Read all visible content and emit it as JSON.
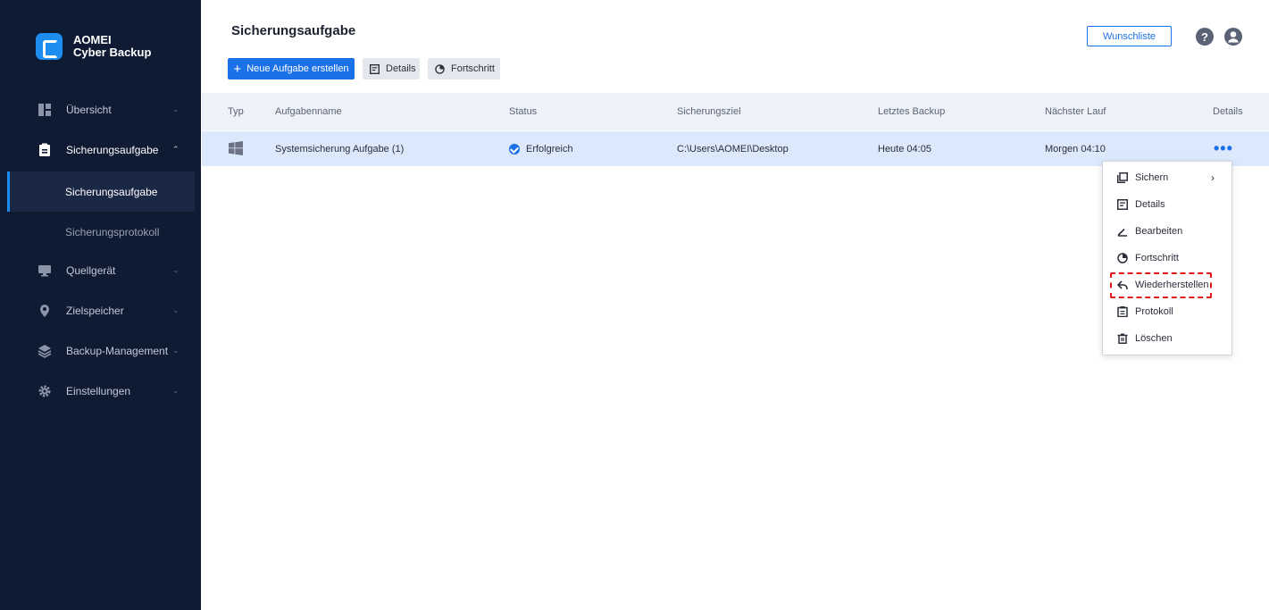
{
  "brand": {
    "line1": "AOMEI",
    "line2": "Cyber Backup",
    "color": "#1d8ef0"
  },
  "sidebar": {
    "items": [
      {
        "label": "Übersicht",
        "icon": "dashboard-icon"
      },
      {
        "label": "Sicherungsaufgabe",
        "icon": "clipboard-icon",
        "expanded": true
      },
      {
        "label": "Quellgerät",
        "icon": "monitor-icon"
      },
      {
        "label": "Zielspeicher",
        "icon": "location-pin-icon"
      },
      {
        "label": "Backup-Management",
        "icon": "layers-icon"
      },
      {
        "label": "Einstellungen",
        "icon": "gear-icon"
      }
    ],
    "subitems": [
      {
        "label": "Sicherungsaufgabe",
        "active": true
      },
      {
        "label": "Sicherungsprotokoll",
        "active": false
      }
    ],
    "colors": {
      "background": "#0f1a33",
      "active": "#1a2745",
      "accent": "#1d8ef0"
    }
  },
  "header": {
    "title": "Sicherungsaufgabe",
    "new_task_label": "Neue Aufgabe erstellen",
    "details_label": "Details",
    "progress_label": "Fortschritt",
    "wishlist_label": "Wunschliste",
    "help_glyph": "?"
  },
  "table": {
    "columns": [
      "Typ",
      "Aufgabenname",
      "Status",
      "Sicherungsziel",
      "Letztes Backup",
      "Nächster Lauf",
      "Details"
    ],
    "rows": [
      {
        "type_icon": "windows-icon",
        "name": "Systemsicherung Aufgabe (1)",
        "status": "Erfolgreich",
        "target": "C:\\Users\\AOMEI\\Desktop",
        "last_backup": "Heute 04:05",
        "next_run": "Morgen 04:10",
        "details_glyph": "•••"
      }
    ]
  },
  "context_menu": {
    "items": [
      {
        "label": "Sichern",
        "icon": "copy-icon",
        "submenu_glyph": "›"
      },
      {
        "label": "Details",
        "icon": "details-icon"
      },
      {
        "label": "Bearbeiten",
        "icon": "edit-icon"
      },
      {
        "label": "Fortschritt",
        "icon": "progress-icon"
      },
      {
        "label": "Wiederherstellen",
        "icon": "restore-icon",
        "highlighted": true
      },
      {
        "label": "Protokoll",
        "icon": "log-icon"
      },
      {
        "label": "Löschen",
        "icon": "trash-icon"
      }
    ],
    "highlight_color": "#e01818"
  }
}
